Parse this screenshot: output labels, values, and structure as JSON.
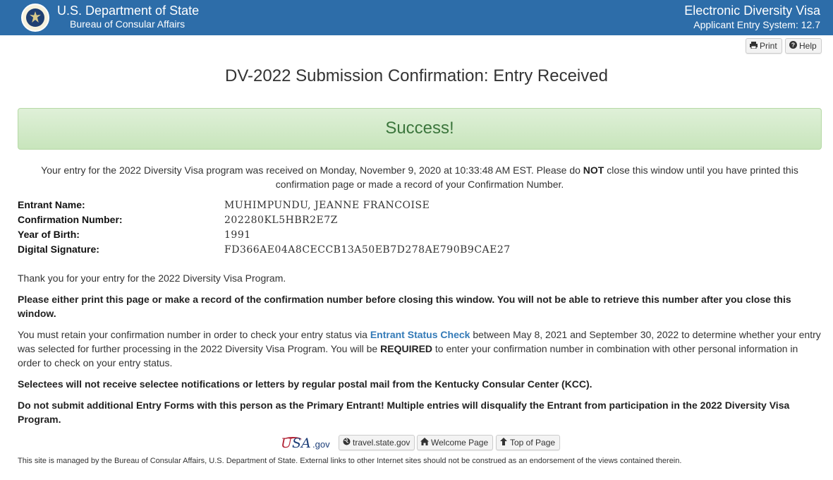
{
  "header": {
    "title": "U.S. Department of State",
    "subtitle": "Bureau of Consular Affairs",
    "right_title": "Electronic Diversity Visa",
    "right_subtitle": "Applicant Entry System: 12.7",
    "seal_icon": "state-department-seal-icon",
    "background_color": "#2d6da9"
  },
  "toolbar": {
    "print_label": "Print",
    "print_icon": "printer-icon",
    "help_label": "Help",
    "help_icon": "question-circle-icon"
  },
  "page_title": "DV-2022 Submission Confirmation: Entry Received",
  "success": {
    "text": "Success!",
    "color": "#3c763d"
  },
  "notice": {
    "part1": "Your entry for the 2022 Diversity Visa program was received on Monday, November 9, 2020 at 10:33:48 AM EST. Please do ",
    "emphasis": "NOT",
    "part2": " close this window until you have printed this confirmation page or made a record of your Confirmation Number."
  },
  "entrant": {
    "name_label": "Entrant Name:",
    "name_value": "MUHIMPUNDU, JEANNE FRANCOISE",
    "confirmation_label": "Confirmation Number:",
    "confirmation_value": "202280KL5HBR2E7Z",
    "year_label": "Year of Birth:",
    "year_value": "1991",
    "signature_label": "Digital Signature:",
    "signature_value": "FD366AE04A8CECCB13A50EB7D278AE790B9CAE27"
  },
  "paragraphs": {
    "thank_you": "Thank you for your entry for the 2022 Diversity Visa Program.",
    "print_warning": "Please either print this page or make a record of the confirmation number before closing this window. You will not be able to retrieve this number after you close this window.",
    "retain_part1": "You must retain your confirmation number in order to check your entry status via ",
    "retain_link": "Entrant Status Check",
    "retain_part2": " between May 8, 2021 and September 30, 2022 to determine whether your entry was selected for further processing in the 2022 Diversity Visa Program. You will be ",
    "retain_required": "REQUIRED",
    "retain_part3": " to enter your confirmation number in combination with other personal information in order to check on your entry status.",
    "selectees": "Selectees will not receive selectee notifications or letters by regular postal mail from the Kentucky Consular Center (KCC).",
    "do_not_submit": "Do not submit additional Entry Forms with this person as the Primary Entrant! Multiple entries will disqualify the Entrant from participation in the 2022 Diversity Visa Program."
  },
  "footer": {
    "usa_gov_logo": "usa-gov-logo",
    "usa_u": "U",
    "usa_sa": "SA",
    "usa_gov": ".gov",
    "travel_label": "travel.state.gov",
    "travel_icon": "globe-icon",
    "welcome_label": "Welcome Page",
    "welcome_icon": "home-icon",
    "top_label": "Top of Page",
    "top_icon": "arrow-up-icon",
    "disclaimer": "This site is managed by the Bureau of Consular Affairs, U.S. Department of State. External links to other Internet sites should not be construed as an endorsement of the views contained therein."
  }
}
